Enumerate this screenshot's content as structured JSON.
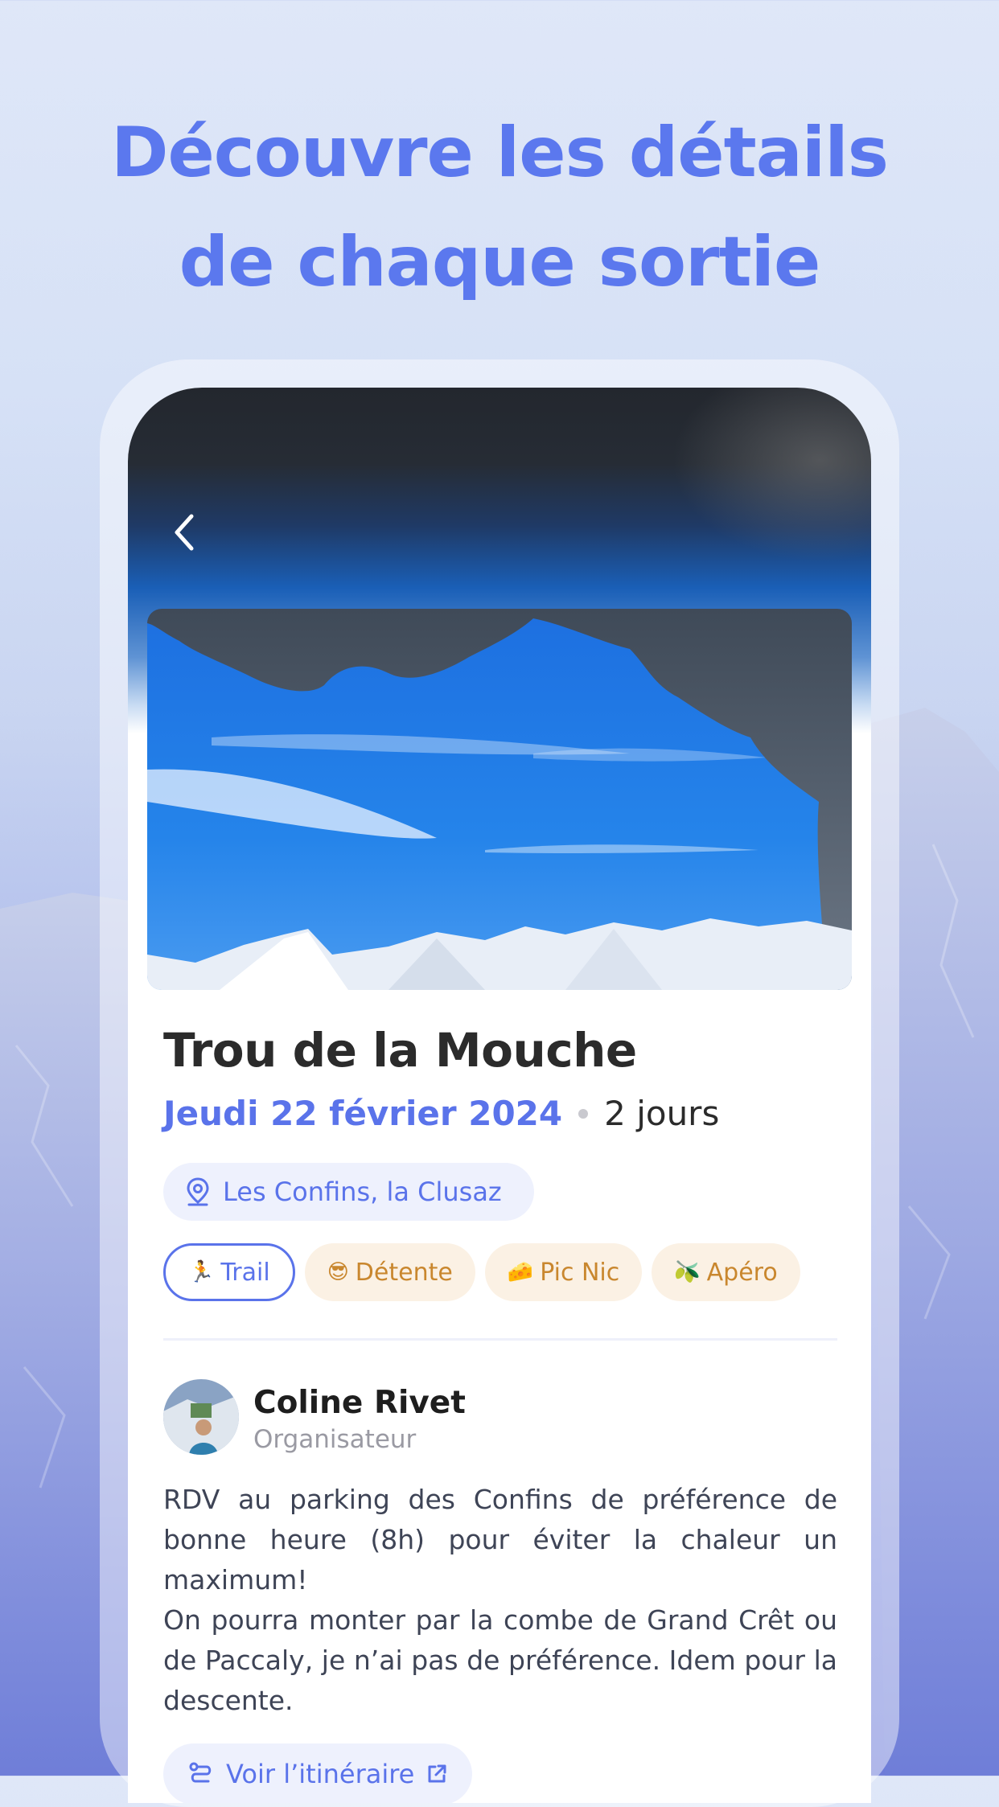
{
  "headline": {
    "line1": "Découvre les détails",
    "line2": "de chaque sortie"
  },
  "outing": {
    "title": "Trou de la Mouche",
    "date": "Jeudi 22 février 2024",
    "duration": "2 jours",
    "location": "Les Confins, la Clusaz",
    "tags": [
      {
        "emoji": "🏃",
        "label": "Trail",
        "style": "primary"
      },
      {
        "emoji": "😎",
        "label": "Détente",
        "style": "warm"
      },
      {
        "emoji": "🧀",
        "label": "Pic Nic",
        "style": "warm"
      },
      {
        "emoji": "🫒",
        "label": "Apéro",
        "style": "warm"
      }
    ]
  },
  "organizer": {
    "name": "Coline Rivet",
    "role": "Organisateur"
  },
  "description": {
    "para1": "RDV au parking des Confins de préférence de bonne heure (8h) pour éviter la chaleur un maximum!",
    "para2": "On pourra monter par la combe de Grand Crêt ou de Paccaly, je n’ai pas de préférence. Idem pour la descente."
  },
  "route_button": {
    "label": "Voir l’itinéraire"
  },
  "colors": {
    "accent": "#5a73ea",
    "warm_tag_bg": "#fbf1e4",
    "warm_tag_text": "#c9872e"
  },
  "icons": {
    "back": "chevron-left-icon",
    "location": "map-pin-icon",
    "route": "route-icon",
    "external": "external-link-icon"
  }
}
